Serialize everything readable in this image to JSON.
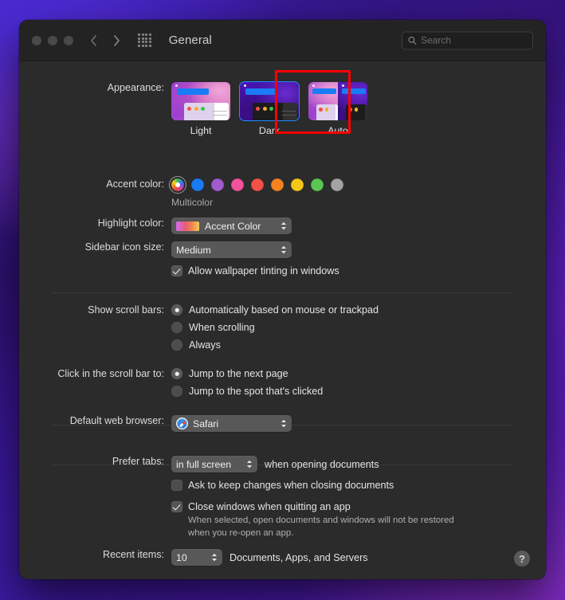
{
  "window": {
    "title": "General",
    "traffic_lights": [
      "close",
      "minimize",
      "zoom"
    ],
    "search": {
      "placeholder": "Search",
      "value": ""
    }
  },
  "appearance": {
    "label": "Appearance:",
    "options": [
      {
        "id": "light",
        "label": "Light",
        "selected": false
      },
      {
        "id": "dark",
        "label": "Dark",
        "selected": true
      },
      {
        "id": "auto",
        "label": "Auto",
        "selected": false
      }
    ],
    "annotation_target": "Dark",
    "annotation_color": "#ff0000"
  },
  "accent_color": {
    "label": "Accent color:",
    "selected": "Multicolor",
    "selected_label": "Multicolor",
    "swatches": [
      {
        "name": "Multicolor",
        "color": "multicolor",
        "selected": true
      },
      {
        "name": "Blue",
        "color": "#1a7cf5",
        "selected": false
      },
      {
        "name": "Purple",
        "color": "#a05ccb",
        "selected": false
      },
      {
        "name": "Pink",
        "color": "#f2529b",
        "selected": false
      },
      {
        "name": "Red",
        "color": "#f45048",
        "selected": false
      },
      {
        "name": "Orange",
        "color": "#f58220",
        "selected": false
      },
      {
        "name": "Yellow",
        "color": "#f5c518",
        "selected": false
      },
      {
        "name": "Green",
        "color": "#5bc martin",
        "selected": false
      },
      {
        "name": "Graphite",
        "color": "#a3a3a3",
        "selected": false
      }
    ]
  },
  "highlight_color": {
    "label": "Highlight color:",
    "value": "Accent Color"
  },
  "sidebar_icon_size": {
    "label": "Sidebar icon size:",
    "value": "Medium"
  },
  "wallpaper_tinting": {
    "label": "Allow wallpaper tinting in windows",
    "checked": true
  },
  "show_scroll_bars": {
    "label": "Show scroll bars:",
    "options": [
      {
        "label": "Automatically based on mouse or trackpad",
        "selected": true
      },
      {
        "label": "When scrolling",
        "selected": false
      },
      {
        "label": "Always",
        "selected": false
      }
    ]
  },
  "click_scroll_bar": {
    "label": "Click in the scroll bar to:",
    "options": [
      {
        "label": "Jump to the next page",
        "selected": true
      },
      {
        "label": "Jump to the spot that's clicked",
        "selected": false
      }
    ]
  },
  "default_web_browser": {
    "label": "Default web browser:",
    "value": "Safari",
    "icon": "safari-icon"
  },
  "prefer_tabs": {
    "label": "Prefer tabs:",
    "value": "in full screen",
    "suffix": "when opening documents"
  },
  "ask_keep_changes": {
    "label": "Ask to keep changes when closing documents",
    "checked": false
  },
  "close_windows": {
    "label": "Close windows when quitting an app",
    "checked": true,
    "description": "When selected, open documents and windows will not be restored when you re-open an app."
  },
  "recent_items": {
    "label": "Recent items:",
    "value": "10",
    "suffix": "Documents, Apps, and Servers"
  },
  "help_button": {
    "glyph": "?"
  }
}
